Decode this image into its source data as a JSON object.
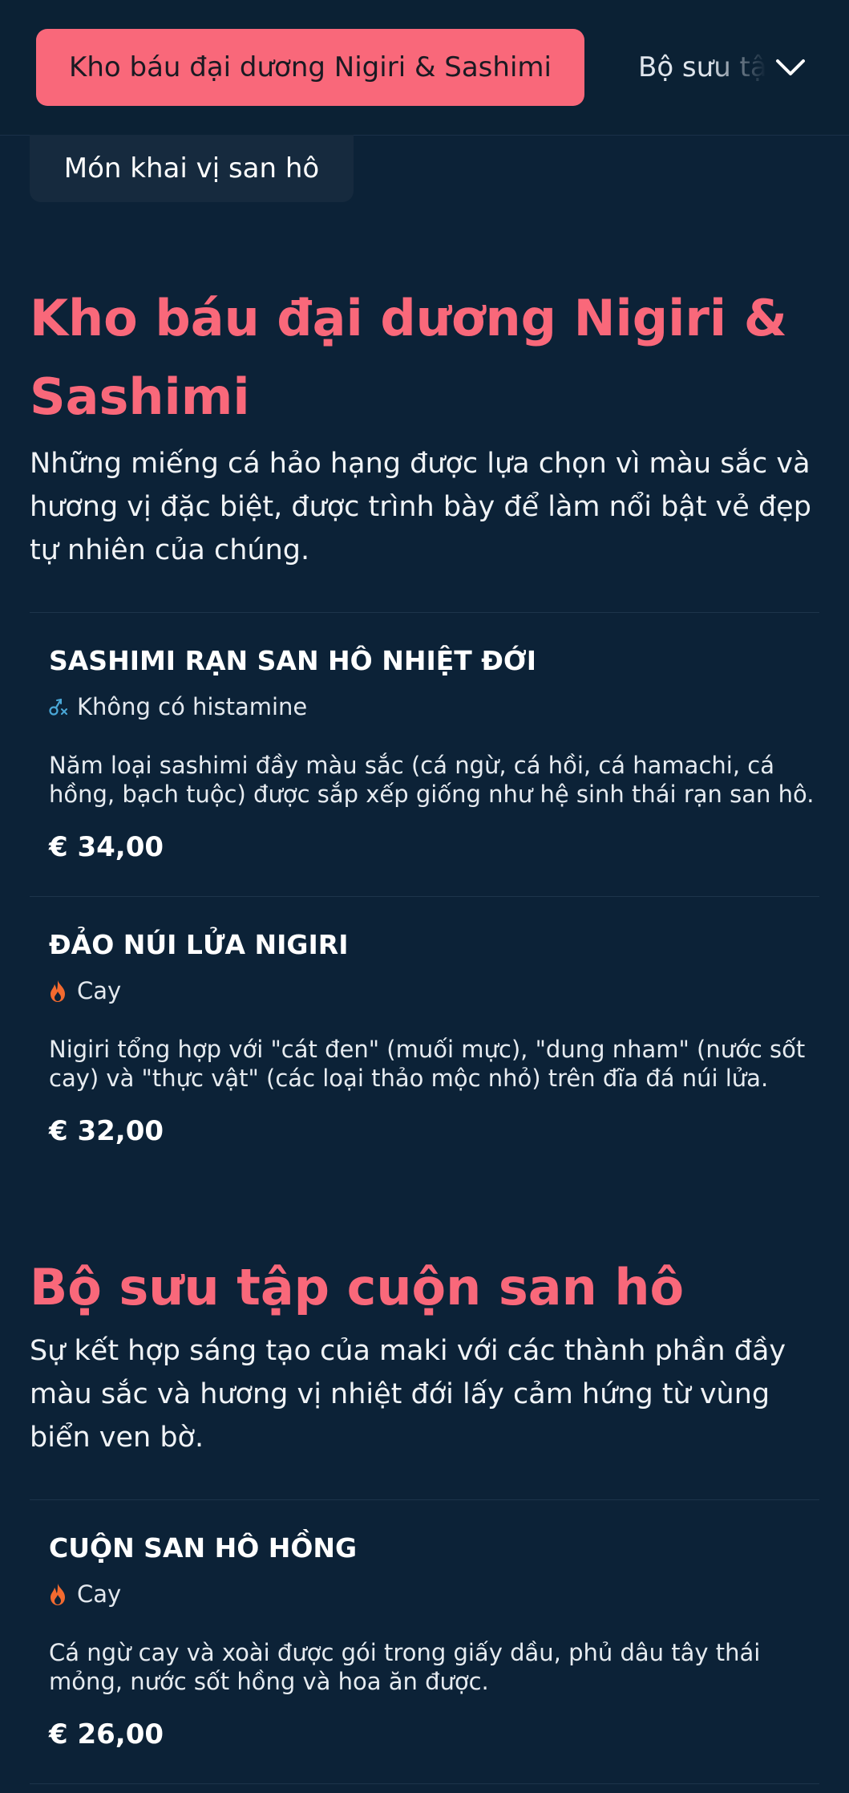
{
  "nav": {
    "active_tab": "Kho báu đại dương Nigiri & Sashimi",
    "next_tab": "Bộ sưu tập cuộn san hô",
    "sub_tab": "Món khai vị san hô"
  },
  "sections": [
    {
      "title": "Kho báu đại dương Nigiri & Sashimi",
      "description": "Những miếng cá hảo hạng được lựa chọn vì màu sắc và hương vị đặc biệt, được trình bày để làm nổi bật vẻ đẹp tự nhiên của chúng.",
      "items": [
        {
          "name": "SASHIMI RẠN SAN HÔ NHIỆT ĐỚI",
          "tag": "Không có histamine",
          "tag_icon": "histamine-free-icon",
          "description": "Năm loại sashimi đầy màu sắc (cá ngừ, cá hồi, cá hamachi, cá hồng, bạch tuộc) được sắp xếp giống như hệ sinh thái rạn san hô.",
          "price": "€ 34,00"
        },
        {
          "name": "ĐẢO NÚI LỬA NIGIRI",
          "tag": "Cay",
          "tag_icon": "flame-icon",
          "description": "Nigiri tổng hợp với \"cát đen\" (muối mực), \"dung nham\" (nước sốt cay) và \"thực vật\" (các loại thảo mộc nhỏ) trên đĩa đá núi lửa.",
          "price": "€ 32,00"
        }
      ]
    },
    {
      "title": "Bộ sưu tập cuộn san hô",
      "description": "Sự kết hợp sáng tạo của maki với các thành phần đầy màu sắc và hương vị nhiệt đới lấy cảm hứng từ vùng biển ven bờ.",
      "items": [
        {
          "name": "CUỘN SAN HÔ HỒNG",
          "tag": "Cay",
          "tag_icon": "flame-icon",
          "description": "Cá ngừ cay và xoài được gói trong giấy dầu, phủ dâu tây thái mỏng, nước sốt hồng và hoa ăn được.",
          "price": "€ 26,00"
        }
      ]
    }
  ],
  "colors": {
    "background": "#0c2237",
    "accent": "#f9687a",
    "spicy_icon": "#f36a2f",
    "histamine_icon": "#4aa8d8"
  }
}
